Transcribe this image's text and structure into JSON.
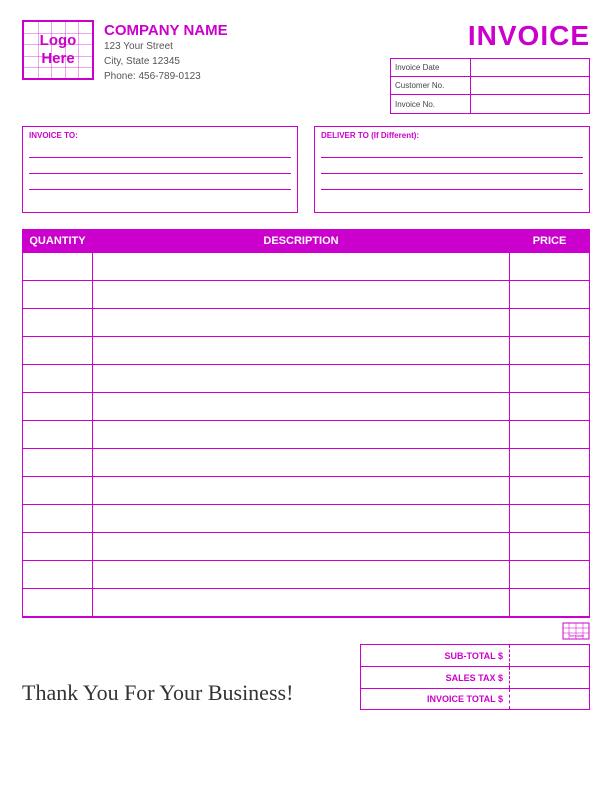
{
  "header": {
    "logo_text_line1": "Logo",
    "logo_text_line2": "Here",
    "company_name": "COMPANY NAME",
    "address_line1": "123 Your Street",
    "address_line2": "City, State 12345",
    "address_line3": "Phone: 456-789-0123",
    "invoice_title": "INVOICE"
  },
  "invoice_fields": [
    {
      "label": "Invoice Date"
    },
    {
      "label": "Customer No."
    },
    {
      "label": "Invoice No."
    }
  ],
  "address_boxes": [
    {
      "label": "INVOICE TO:"
    },
    {
      "label": "DELIVER TO (If Different):"
    }
  ],
  "table": {
    "col_qty": "QUANTITY",
    "col_desc": "DESCRIPTION",
    "col_price": "PRICE",
    "rows": 13
  },
  "totals": [
    {
      "label": "SUB-TOTAL $"
    },
    {
      "label": "SALES TAX $"
    },
    {
      "label": "INVOICE TOTAL $"
    }
  ],
  "footer": {
    "thank_you": "Thank You For Your Business!"
  }
}
